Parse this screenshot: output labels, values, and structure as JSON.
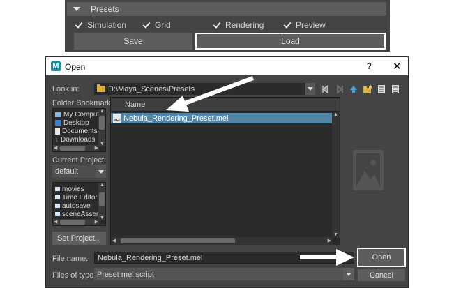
{
  "presets": {
    "title": "Presets",
    "options": [
      {
        "label": "Simulation",
        "checked": true
      },
      {
        "label": "Grid",
        "checked": true
      },
      {
        "label": "Rendering",
        "checked": true
      },
      {
        "label": "Preview",
        "checked": true
      }
    ],
    "save_label": "Save",
    "load_label": "Load"
  },
  "dialog": {
    "title": "Open",
    "help": "?",
    "close": "✕",
    "look_in_label": "Look in:",
    "look_in_value": "D:\\Maya_Scenes\\Presets",
    "folder_bookmarks_label": "Folder Bookmarks:",
    "bookmarks": [
      "My Compute",
      "Desktop",
      "Documents",
      "Downloads"
    ],
    "current_project_label": "Current Project:",
    "current_project_value": "default",
    "project_folders": [
      "movies",
      "Time Editor",
      "autosave",
      "sceneAsseml"
    ],
    "set_project_label": "Set Project...",
    "column_name": "Name",
    "files": [
      "Nebula_Rendering_Preset.mel"
    ],
    "file_name_label": "File name:",
    "file_name_value": "Nebula_Rendering_Preset.mel",
    "files_of_type_label": "Files of type:",
    "files_of_type_value": "Preset mel script",
    "open_label": "Open",
    "cancel_label": "Cancel"
  },
  "colors": {
    "panel_bg": "#444444",
    "button_bg": "#5d5d5d",
    "selection": "#5285a6",
    "highlight_border": "#ffffff"
  }
}
